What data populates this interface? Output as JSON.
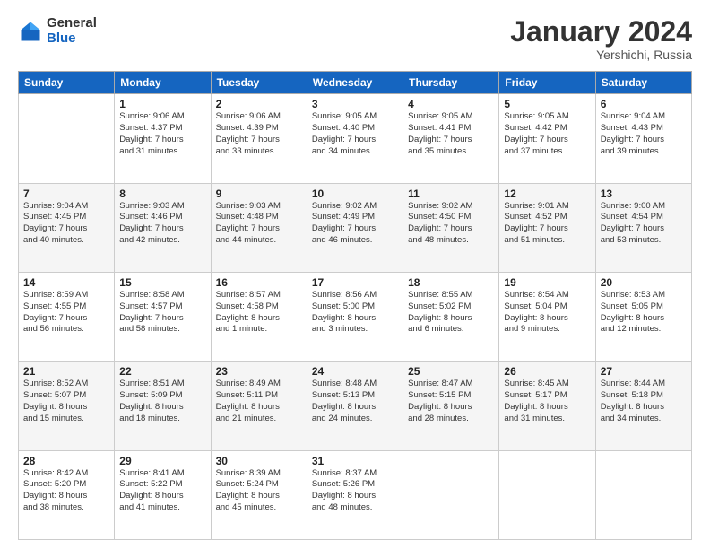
{
  "logo": {
    "general": "General",
    "blue": "Blue"
  },
  "title": "January 2024",
  "location": "Yershichi, Russia",
  "days_of_week": [
    "Sunday",
    "Monday",
    "Tuesday",
    "Wednesday",
    "Thursday",
    "Friday",
    "Saturday"
  ],
  "weeks": [
    [
      {
        "day": "",
        "info": ""
      },
      {
        "day": "1",
        "info": "Sunrise: 9:06 AM\nSunset: 4:37 PM\nDaylight: 7 hours\nand 31 minutes."
      },
      {
        "day": "2",
        "info": "Sunrise: 9:06 AM\nSunset: 4:39 PM\nDaylight: 7 hours\nand 33 minutes."
      },
      {
        "day": "3",
        "info": "Sunrise: 9:05 AM\nSunset: 4:40 PM\nDaylight: 7 hours\nand 34 minutes."
      },
      {
        "day": "4",
        "info": "Sunrise: 9:05 AM\nSunset: 4:41 PM\nDaylight: 7 hours\nand 35 minutes."
      },
      {
        "day": "5",
        "info": "Sunrise: 9:05 AM\nSunset: 4:42 PM\nDaylight: 7 hours\nand 37 minutes."
      },
      {
        "day": "6",
        "info": "Sunrise: 9:04 AM\nSunset: 4:43 PM\nDaylight: 7 hours\nand 39 minutes."
      }
    ],
    [
      {
        "day": "7",
        "info": "Sunrise: 9:04 AM\nSunset: 4:45 PM\nDaylight: 7 hours\nand 40 minutes."
      },
      {
        "day": "8",
        "info": "Sunrise: 9:03 AM\nSunset: 4:46 PM\nDaylight: 7 hours\nand 42 minutes."
      },
      {
        "day": "9",
        "info": "Sunrise: 9:03 AM\nSunset: 4:48 PM\nDaylight: 7 hours\nand 44 minutes."
      },
      {
        "day": "10",
        "info": "Sunrise: 9:02 AM\nSunset: 4:49 PM\nDaylight: 7 hours\nand 46 minutes."
      },
      {
        "day": "11",
        "info": "Sunrise: 9:02 AM\nSunset: 4:50 PM\nDaylight: 7 hours\nand 48 minutes."
      },
      {
        "day": "12",
        "info": "Sunrise: 9:01 AM\nSunset: 4:52 PM\nDaylight: 7 hours\nand 51 minutes."
      },
      {
        "day": "13",
        "info": "Sunrise: 9:00 AM\nSunset: 4:54 PM\nDaylight: 7 hours\nand 53 minutes."
      }
    ],
    [
      {
        "day": "14",
        "info": "Sunrise: 8:59 AM\nSunset: 4:55 PM\nDaylight: 7 hours\nand 56 minutes."
      },
      {
        "day": "15",
        "info": "Sunrise: 8:58 AM\nSunset: 4:57 PM\nDaylight: 7 hours\nand 58 minutes."
      },
      {
        "day": "16",
        "info": "Sunrise: 8:57 AM\nSunset: 4:58 PM\nDaylight: 8 hours\nand 1 minute."
      },
      {
        "day": "17",
        "info": "Sunrise: 8:56 AM\nSunset: 5:00 PM\nDaylight: 8 hours\nand 3 minutes."
      },
      {
        "day": "18",
        "info": "Sunrise: 8:55 AM\nSunset: 5:02 PM\nDaylight: 8 hours\nand 6 minutes."
      },
      {
        "day": "19",
        "info": "Sunrise: 8:54 AM\nSunset: 5:04 PM\nDaylight: 8 hours\nand 9 minutes."
      },
      {
        "day": "20",
        "info": "Sunrise: 8:53 AM\nSunset: 5:05 PM\nDaylight: 8 hours\nand 12 minutes."
      }
    ],
    [
      {
        "day": "21",
        "info": "Sunrise: 8:52 AM\nSunset: 5:07 PM\nDaylight: 8 hours\nand 15 minutes."
      },
      {
        "day": "22",
        "info": "Sunrise: 8:51 AM\nSunset: 5:09 PM\nDaylight: 8 hours\nand 18 minutes."
      },
      {
        "day": "23",
        "info": "Sunrise: 8:49 AM\nSunset: 5:11 PM\nDaylight: 8 hours\nand 21 minutes."
      },
      {
        "day": "24",
        "info": "Sunrise: 8:48 AM\nSunset: 5:13 PM\nDaylight: 8 hours\nand 24 minutes."
      },
      {
        "day": "25",
        "info": "Sunrise: 8:47 AM\nSunset: 5:15 PM\nDaylight: 8 hours\nand 28 minutes."
      },
      {
        "day": "26",
        "info": "Sunrise: 8:45 AM\nSunset: 5:17 PM\nDaylight: 8 hours\nand 31 minutes."
      },
      {
        "day": "27",
        "info": "Sunrise: 8:44 AM\nSunset: 5:18 PM\nDaylight: 8 hours\nand 34 minutes."
      }
    ],
    [
      {
        "day": "28",
        "info": "Sunrise: 8:42 AM\nSunset: 5:20 PM\nDaylight: 8 hours\nand 38 minutes."
      },
      {
        "day": "29",
        "info": "Sunrise: 8:41 AM\nSunset: 5:22 PM\nDaylight: 8 hours\nand 41 minutes."
      },
      {
        "day": "30",
        "info": "Sunrise: 8:39 AM\nSunset: 5:24 PM\nDaylight: 8 hours\nand 45 minutes."
      },
      {
        "day": "31",
        "info": "Sunrise: 8:37 AM\nSunset: 5:26 PM\nDaylight: 8 hours\nand 48 minutes."
      },
      {
        "day": "",
        "info": ""
      },
      {
        "day": "",
        "info": ""
      },
      {
        "day": "",
        "info": ""
      }
    ]
  ]
}
